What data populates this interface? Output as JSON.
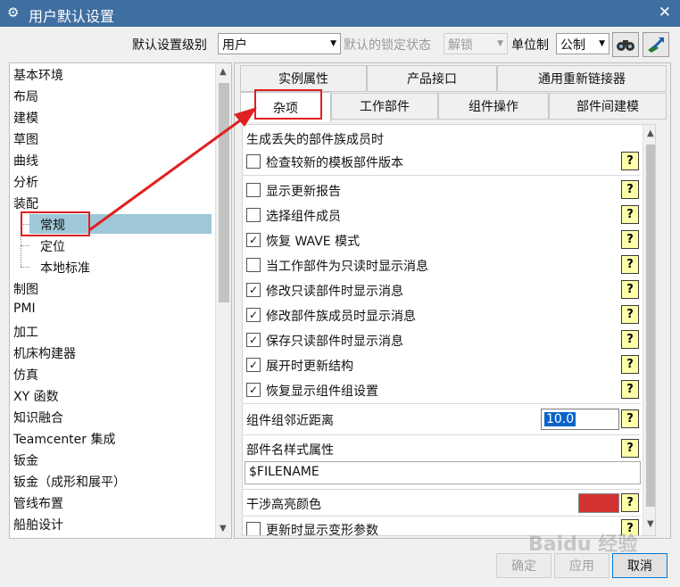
{
  "window": {
    "title": "用户默认设置",
    "gear_icon": "gear-icon",
    "close_icon": "close-icon"
  },
  "toolbar": {
    "level_label": "默认设置级别",
    "level_value": "用户",
    "lock_label": "默认的锁定状态",
    "lock_value": "解锁",
    "unit_label": "单位制",
    "unit_value": "公制",
    "icons": [
      "binoculars-icon",
      "export-icon"
    ]
  },
  "tree": {
    "items": [
      {
        "label": "基本环境"
      },
      {
        "label": "布局"
      },
      {
        "label": "建模"
      },
      {
        "label": "草图"
      },
      {
        "label": "曲线"
      },
      {
        "label": "分析"
      },
      {
        "label": "装配"
      },
      {
        "label": "常规",
        "child": true,
        "selected": true
      },
      {
        "label": "定位",
        "child": true
      },
      {
        "label": "本地标准",
        "child": true
      },
      {
        "label": "制图"
      },
      {
        "label": "PMI"
      },
      {
        "label": "加工"
      },
      {
        "label": "机床构建器"
      },
      {
        "label": "仿真"
      },
      {
        "label": "XY 函数"
      },
      {
        "label": "知识融合"
      },
      {
        "label": "Teamcenter 集成"
      },
      {
        "label": "钣金"
      },
      {
        "label": "钣金（成形和展平）"
      },
      {
        "label": "管线布置"
      },
      {
        "label": "船舶设计"
      }
    ]
  },
  "tabs": {
    "row1": [
      "实例属性",
      "产品接口",
      "通用重新链接器"
    ],
    "row2": [
      "杂项",
      "工作部件",
      "组件操作",
      "部件间建模"
    ],
    "active": "杂项"
  },
  "settings": {
    "section1": "生成丢失的部件族成员时",
    "check_newer": {
      "label": "检查较新的模板部件版本",
      "checked": false
    },
    "options": [
      {
        "label": "显示更新报告",
        "checked": false
      },
      {
        "label": "选择组件成员",
        "checked": false
      },
      {
        "label": "恢复 WAVE 模式",
        "checked": true
      },
      {
        "label": "当工作部件为只读时显示消息",
        "checked": false
      },
      {
        "label": "修改只读部件时显示消息",
        "checked": true
      },
      {
        "label": "修改部件族成员时显示消息",
        "checked": true
      },
      {
        "label": "保存只读部件时显示消息",
        "checked": true
      },
      {
        "label": "展开时更新结构",
        "checked": true
      },
      {
        "label": "恢复显示组件组设置",
        "checked": true
      }
    ],
    "proximity_label": "组件组邻近距离",
    "proximity_value": "10.0",
    "name_attr_label": "部件名样式属性",
    "name_attr_value": "$FILENAME",
    "interference_label": "干涉高亮颜色",
    "interference_color": "#d33232",
    "last_option": {
      "label": "更新时显示变形参数",
      "checked": false
    },
    "help_glyph": "?"
  },
  "buttons": {
    "ok": "确定",
    "apply": "应用",
    "cancel": "取消"
  },
  "watermark": "Baidu 经验",
  "check_glyph": "✓"
}
